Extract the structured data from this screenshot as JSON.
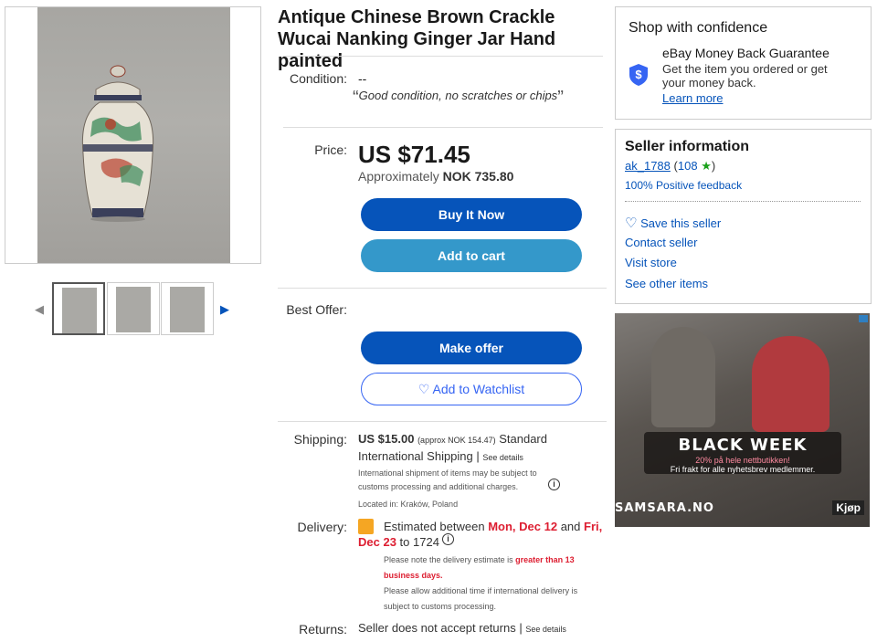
{
  "listing": {
    "title": "Antique Chinese Brown Crackle Wucai Nanking Ginger Jar Hand painted"
  },
  "images": {
    "main_alt": "Ginger jar photo",
    "thumbnails": [
      "thumb 1",
      "thumb 2",
      "thumb 3"
    ],
    "prev_icon": "chevron-left-icon",
    "next_icon": "chevron-right-icon"
  },
  "condition": {
    "label": "Condition:",
    "value": "--",
    "note": "Good condition, no scratches or chips",
    "open_quote": "“",
    "close_quote": "”"
  },
  "price": {
    "label": "Price:",
    "amount": "US $71.45",
    "approx_prefix": "Approximately",
    "approx_value": "NOK 735.80"
  },
  "buttons": {
    "buy_now": "Buy It Now",
    "add_to_cart": "Add to cart",
    "make_offer": "Make offer",
    "add_to_watchlist": "Add to Watchlist"
  },
  "best_offer": {
    "label": "Best Offer:"
  },
  "shipping": {
    "label": "Shipping:",
    "amount": "US $15.00",
    "approx": "(approx NOK 154.47)",
    "method": "Standard International Shipping",
    "separator": "|",
    "see_details": "See details",
    "note": "International shipment of items may be subject to customs processing and additional charges.",
    "located": "Located in: Kraków, Poland"
  },
  "delivery": {
    "label": "Delivery:",
    "prefix": "Estimated between",
    "start": "Mon, Dec 12",
    "and": "and",
    "end": "Fri, Dec 23",
    "to": "to 1724",
    "note_prefix": "Please note the delivery estimate is",
    "note_emph": "greater than 13 business days.",
    "note2": "Please allow additional time if international delivery is subject to customs processing."
  },
  "returns": {
    "label": "Returns:",
    "text": "Seller does not accept returns",
    "separator": "|",
    "see_details": "See details"
  },
  "confidence": {
    "title": "Shop with confidence",
    "guarantee_title": "eBay Money Back Guarantee",
    "guarantee_text": "Get the item you ordered or get your money back.",
    "learn_more": "Learn more"
  },
  "seller": {
    "title": "Seller information",
    "name": "ak_1788",
    "score_open": "(",
    "score": "108",
    "score_close": ")",
    "feedback": "100% Positive feedback",
    "save": "Save this seller",
    "contact": "Contact seller",
    "visit": "Visit store",
    "other": "See other items"
  },
  "ad": {
    "headline": "BLACK WEEK",
    "sub1": "20% på hele nettbutikken!",
    "sub2": "Fri frakt for alle nyhetsbrev medlemmer.",
    "brand": "SAMSARA.NO",
    "cta": "Kjøp"
  },
  "colors": {
    "link": "#0654ba",
    "primary_button": "#0654ba",
    "cart_button": "#3498ca",
    "alert_red": "#dd1e31",
    "star": "#1ba11b"
  }
}
